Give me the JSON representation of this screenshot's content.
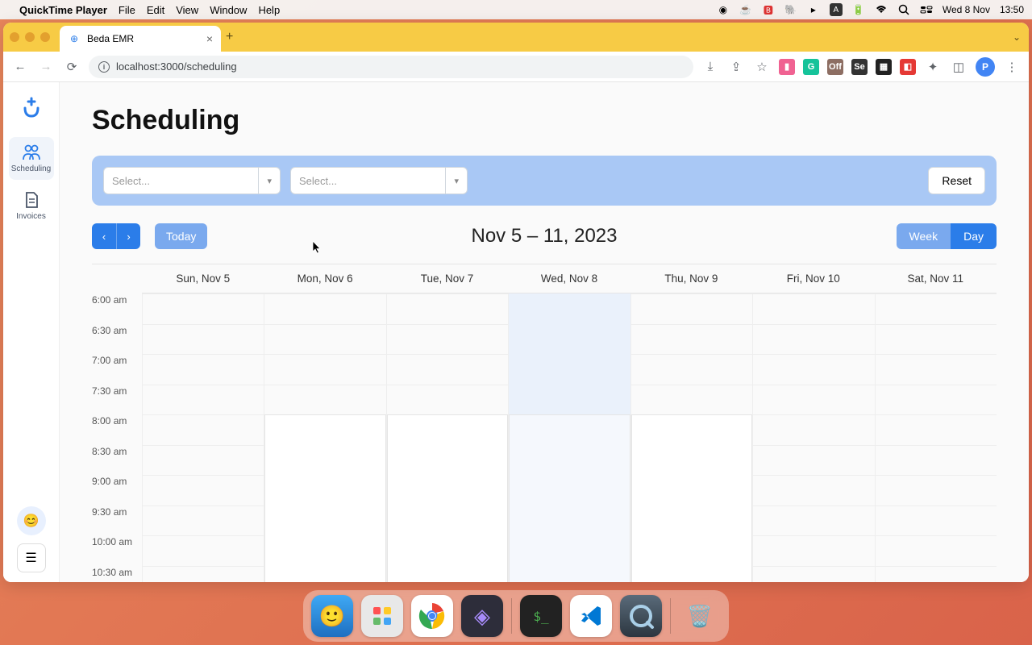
{
  "menubar": {
    "app": "QuickTime Player",
    "items": [
      "File",
      "Edit",
      "View",
      "Window",
      "Help"
    ],
    "date": "Wed 8 Nov",
    "time": "13:50"
  },
  "browser": {
    "tab_title": "Beda EMR",
    "url": "localhost:3000/scheduling"
  },
  "sidebar": {
    "items": [
      {
        "label": "Scheduling",
        "icon": "users",
        "active": true
      },
      {
        "label": "Invoices",
        "icon": "file",
        "active": false
      }
    ]
  },
  "page": {
    "title": "Scheduling",
    "select1_placeholder": "Select...",
    "select2_placeholder": "Select...",
    "reset_label": "Reset",
    "today_label": "Today",
    "range_title": "Nov 5 – 11, 2023",
    "week_label": "Week",
    "day_label": "Day",
    "day_headers": [
      "Sun, Nov 5",
      "Mon, Nov 6",
      "Tue, Nov 7",
      "Wed, Nov 8",
      "Thu, Nov 9",
      "Fri, Nov 10",
      "Sat, Nov 11"
    ],
    "time_slots": [
      "6:00 am",
      "6:30 am",
      "7:00 am",
      "7:30 am",
      "8:00 am",
      "8:30 am",
      "9:00 am",
      "9:30 am",
      "10:00 am",
      "10:30 am"
    ]
  }
}
